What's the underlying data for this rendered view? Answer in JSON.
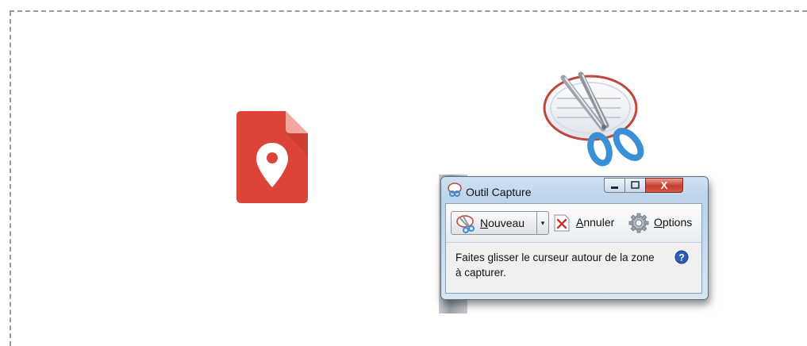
{
  "window": {
    "title": "Outil Capture",
    "close_glyph": "X"
  },
  "toolbar": {
    "new_label_first": "N",
    "new_label_rest": "ouveau",
    "dropdown_glyph": "▾",
    "cancel_label_first": "A",
    "cancel_label_rest": "nnuler",
    "options_label_first": "O",
    "options_label_rest": "ptions"
  },
  "hint": {
    "text": "Faites glisser le curseur autour de la zone à capturer."
  },
  "icons": {
    "maps": "google-my-maps-icon",
    "snipping_logo": "snipping-tool-logo",
    "scissors": "scissors-icon",
    "cancel": "red-x-icon",
    "options": "gear-icon",
    "help": "help-icon"
  },
  "colors": {
    "maps_red": "#db4437",
    "help_blue": "#2d5fb8",
    "scissor_blue": "#3a8fd6"
  }
}
